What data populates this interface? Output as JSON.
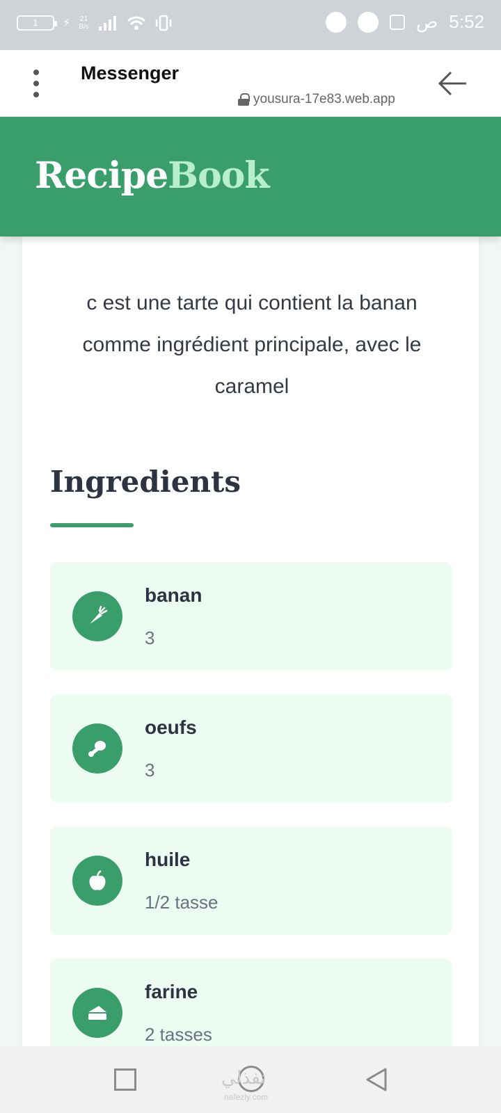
{
  "status_bar": {
    "battery": "1",
    "net_speed_value": "21",
    "net_speed_unit": "B/s",
    "period": "ص",
    "time": "5:52"
  },
  "browser": {
    "title": "Messenger",
    "url": "yousura-17e83.web.app"
  },
  "app": {
    "brand_part1": "Recipe",
    "brand_part2": "Book",
    "brand_color_1": "#ffffff",
    "brand_color_2": "#b6efc9",
    "header_color": "#3a9e6b"
  },
  "recipe": {
    "description": "c est une tarte qui contient la banan comme ingrédient principale, avec le caramel",
    "ingredients_title": "Ingredients",
    "ingredients": [
      {
        "name": "banan",
        "quantity": "3",
        "icon": "carrot-icon"
      },
      {
        "name": "oeufs",
        "quantity": "3",
        "icon": "drumstick-icon"
      },
      {
        "name": "huile",
        "quantity": "1/2 tasse",
        "icon": "apple-icon"
      },
      {
        "name": "farine",
        "quantity": "2 tasses",
        "icon": "cheese-icon"
      }
    ]
  },
  "watermark": {
    "text": "نفذلي",
    "sub": "nafezly.com"
  }
}
